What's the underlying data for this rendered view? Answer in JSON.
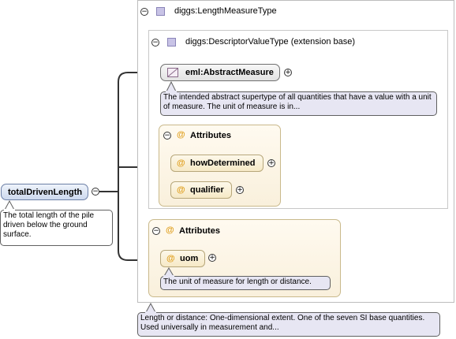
{
  "diagram": {
    "root": {
      "name": "totalDrivenLength",
      "doc": "The total length of the pile driven below the ground surface."
    },
    "type_box": {
      "name": "diggs:LengthMeasureType",
      "doc": "Length or distance: One-dimensional extent. One of the seven SI base quantities. Used universally in measurement and..."
    },
    "base_box": {
      "name": "diggs:DescriptorValueType (extension base)"
    },
    "abstract_measure": {
      "name": "eml:AbstractMeasure",
      "doc": "The intended abstract supertype of all quantities that have a value with a unit of measure. The unit of measure is in..."
    },
    "attributes_inner": {
      "title": "Attributes",
      "items": [
        "howDetermined",
        "qualifier"
      ]
    },
    "attributes_outer": {
      "title": "Attributes",
      "items": [
        "uom"
      ],
      "uom_doc": "The unit of measure for length or distance."
    },
    "symbols": {
      "collapse": "−",
      "expand": "+",
      "attribute": "@"
    }
  }
}
